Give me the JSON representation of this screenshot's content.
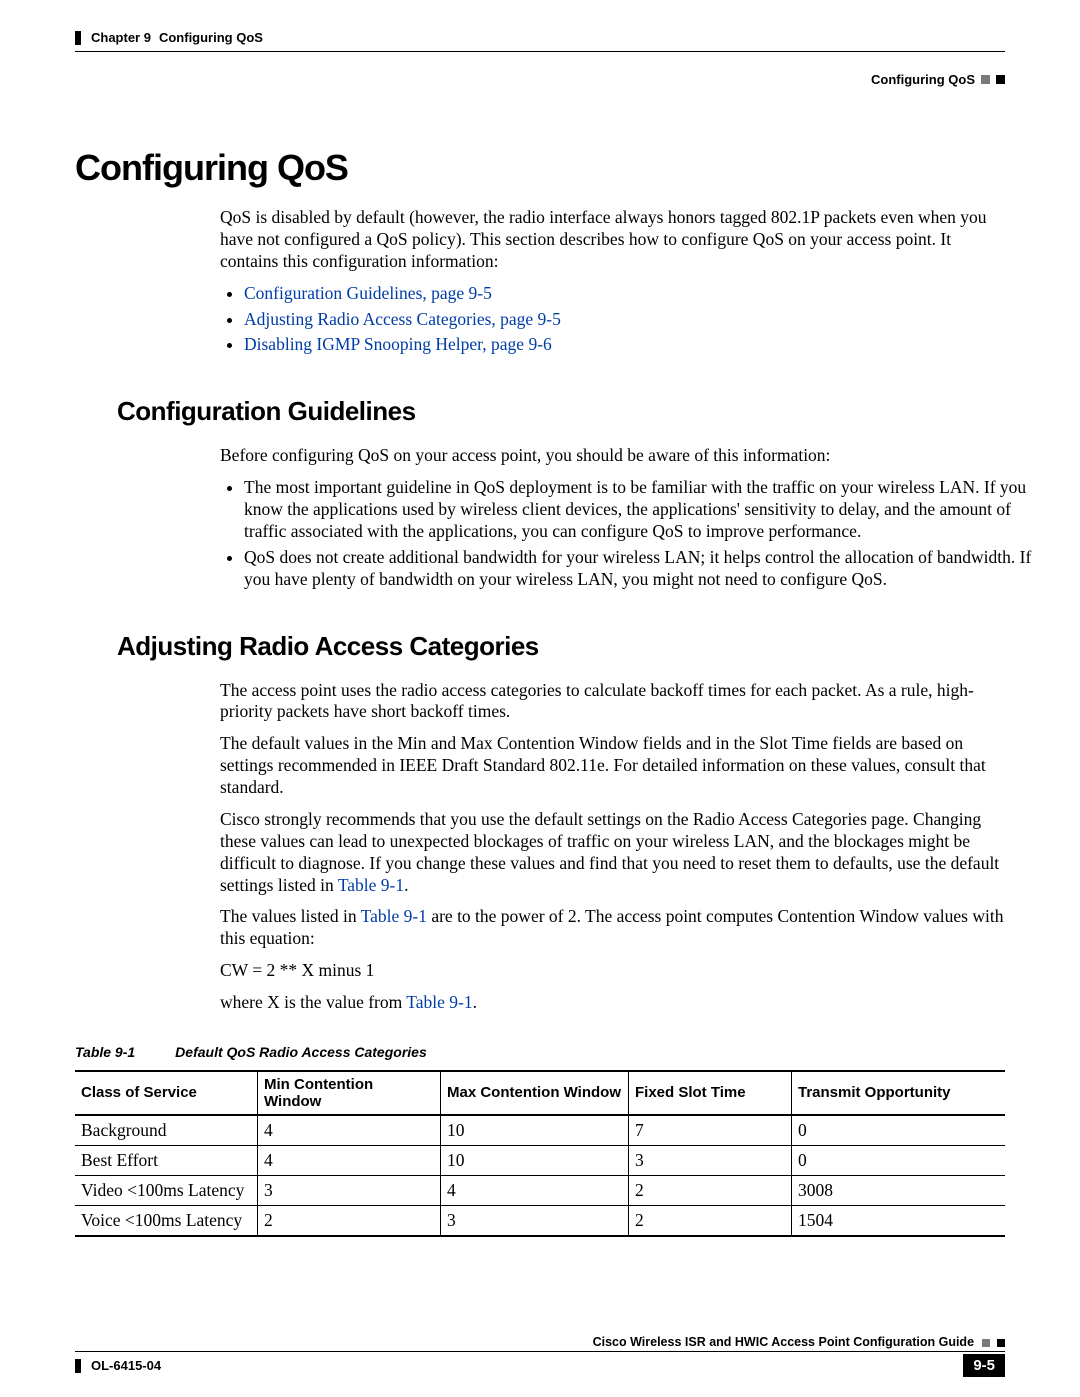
{
  "header": {
    "chapter_label": "Chapter 9",
    "chapter_title": "Configuring QoS",
    "section_title": "Configuring QoS"
  },
  "h1": "Configuring QoS",
  "intro_para": "QoS is disabled by default (however, the radio interface always honors tagged 802.1P packets even when you have not configured a QoS policy). This section describes how to configure QoS on your access point. It contains this configuration information:",
  "toc": [
    "Configuration Guidelines, page 9-5",
    "Adjusting Radio Access Categories, page 9-5",
    "Disabling IGMP Snooping Helper, page 9-6"
  ],
  "sec1": {
    "title": "Configuration Guidelines",
    "lead": "Before configuring QoS on your access point, you should be aware of this information:",
    "bullets": [
      "The most important guideline in QoS deployment is to be familiar with the traffic on your wireless LAN. If you know the applications used by wireless client devices, the applications' sensitivity to delay, and the amount of traffic associated with the applications, you can configure QoS to improve performance.",
      "QoS does not create additional bandwidth for your wireless LAN; it helps control the allocation of bandwidth. If you have plenty of bandwidth on your wireless LAN, you might not need to configure QoS."
    ]
  },
  "sec2": {
    "title": "Adjusting Radio Access Categories",
    "p1": "The access point uses the radio access categories to calculate backoff times for each packet. As a rule, high-priority packets have short backoff times.",
    "p2": "The default values in the Min and Max Contention Window fields and in the Slot Time fields are based on settings recommended in IEEE Draft Standard 802.11e. For detailed information on these values, consult that standard.",
    "p3_a": "Cisco strongly recommends that you use the default settings on the Radio Access Categories page. Changing these values can lead to unexpected blockages of traffic on your wireless LAN, and the blockages might be difficult to diagnose. If you change these values and find that you need to reset them to defaults, use the default settings listed in ",
    "p3_link": "Table 9-1",
    "p3_b": ".",
    "p4_a": "The values listed in ",
    "p4_link": "Table 9-1",
    "p4_b": " are to the power of 2. The access point computes Contention Window values with this equation:",
    "eq": "CW = 2 ** X minus 1",
    "p5_a": "where X is the value from ",
    "p5_link": "Table 9-1",
    "p5_b": "."
  },
  "table": {
    "caption_num": "Table 9-1",
    "caption_title": "Default QoS Radio Access Categories",
    "headers": [
      "Class of Service",
      "Min Contention Window",
      "Max Contention Window",
      "Fixed Slot Time",
      "Transmit Opportunity"
    ],
    "rows": [
      [
        "Background",
        "4",
        "10",
        "7",
        "0"
      ],
      [
        "Best Effort",
        "4",
        "10",
        "3",
        "0"
      ],
      [
        "Video <100ms Latency",
        "3",
        "4",
        "2",
        "3008"
      ],
      [
        "Voice <100ms Latency",
        "2",
        "3",
        "2",
        "1504"
      ]
    ]
  },
  "footer": {
    "book_title": "Cisco Wireless ISR and HWIC Access Point Configuration Guide",
    "doc_id": "OL-6415-04",
    "page_num": "9-5"
  }
}
